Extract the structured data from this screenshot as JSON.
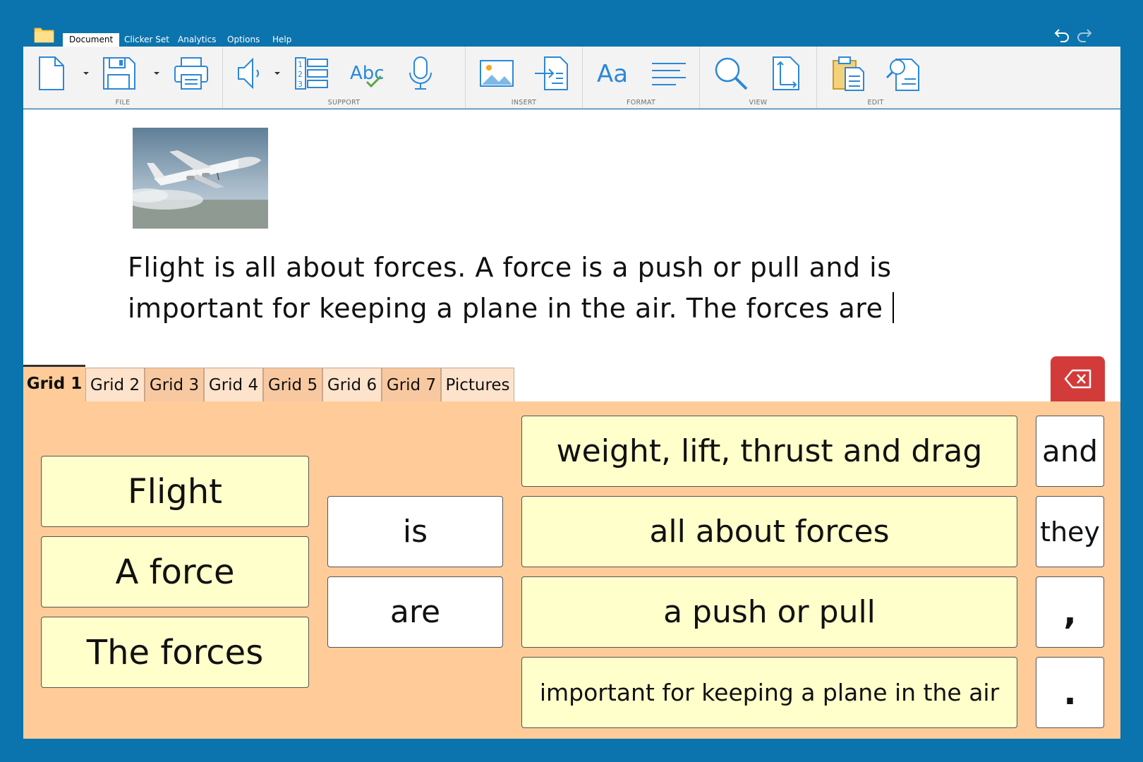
{
  "menu": {
    "tabs": [
      "Document",
      "Clicker Set",
      "Analytics",
      "Options",
      "Help"
    ],
    "active": "Document"
  },
  "ribbon": {
    "groups": [
      "FILE",
      "SUPPORT",
      "INSERT",
      "FORMAT",
      "VIEW",
      "EDIT"
    ]
  },
  "document": {
    "text_line1": "Flight is all about forces. A force is a push or pull and is",
    "text_line2": "important for keeping a plane in the air. The forces are"
  },
  "grid_tabs": [
    "Grid 1",
    "Grid 2",
    "Grid 3",
    "Grid 4",
    "Grid 5",
    "Grid 6",
    "Grid 7",
    "Pictures"
  ],
  "grid": {
    "col1": [
      "Flight",
      "A force",
      "The forces"
    ],
    "col2": [
      "is",
      "are"
    ],
    "col3": [
      "weight, lift, thrust and drag",
      "all about forces",
      "a push or pull",
      "important for keeping a plane in the air"
    ],
    "col4": [
      "and",
      "they",
      ",",
      "."
    ]
  },
  "colors": {
    "frame": "#0b73ad",
    "grid_bg": "#ffcc99",
    "cell_yellow": "#ffffcc",
    "delete": "#d33b3b",
    "icon_blue": "#2b88d8"
  }
}
